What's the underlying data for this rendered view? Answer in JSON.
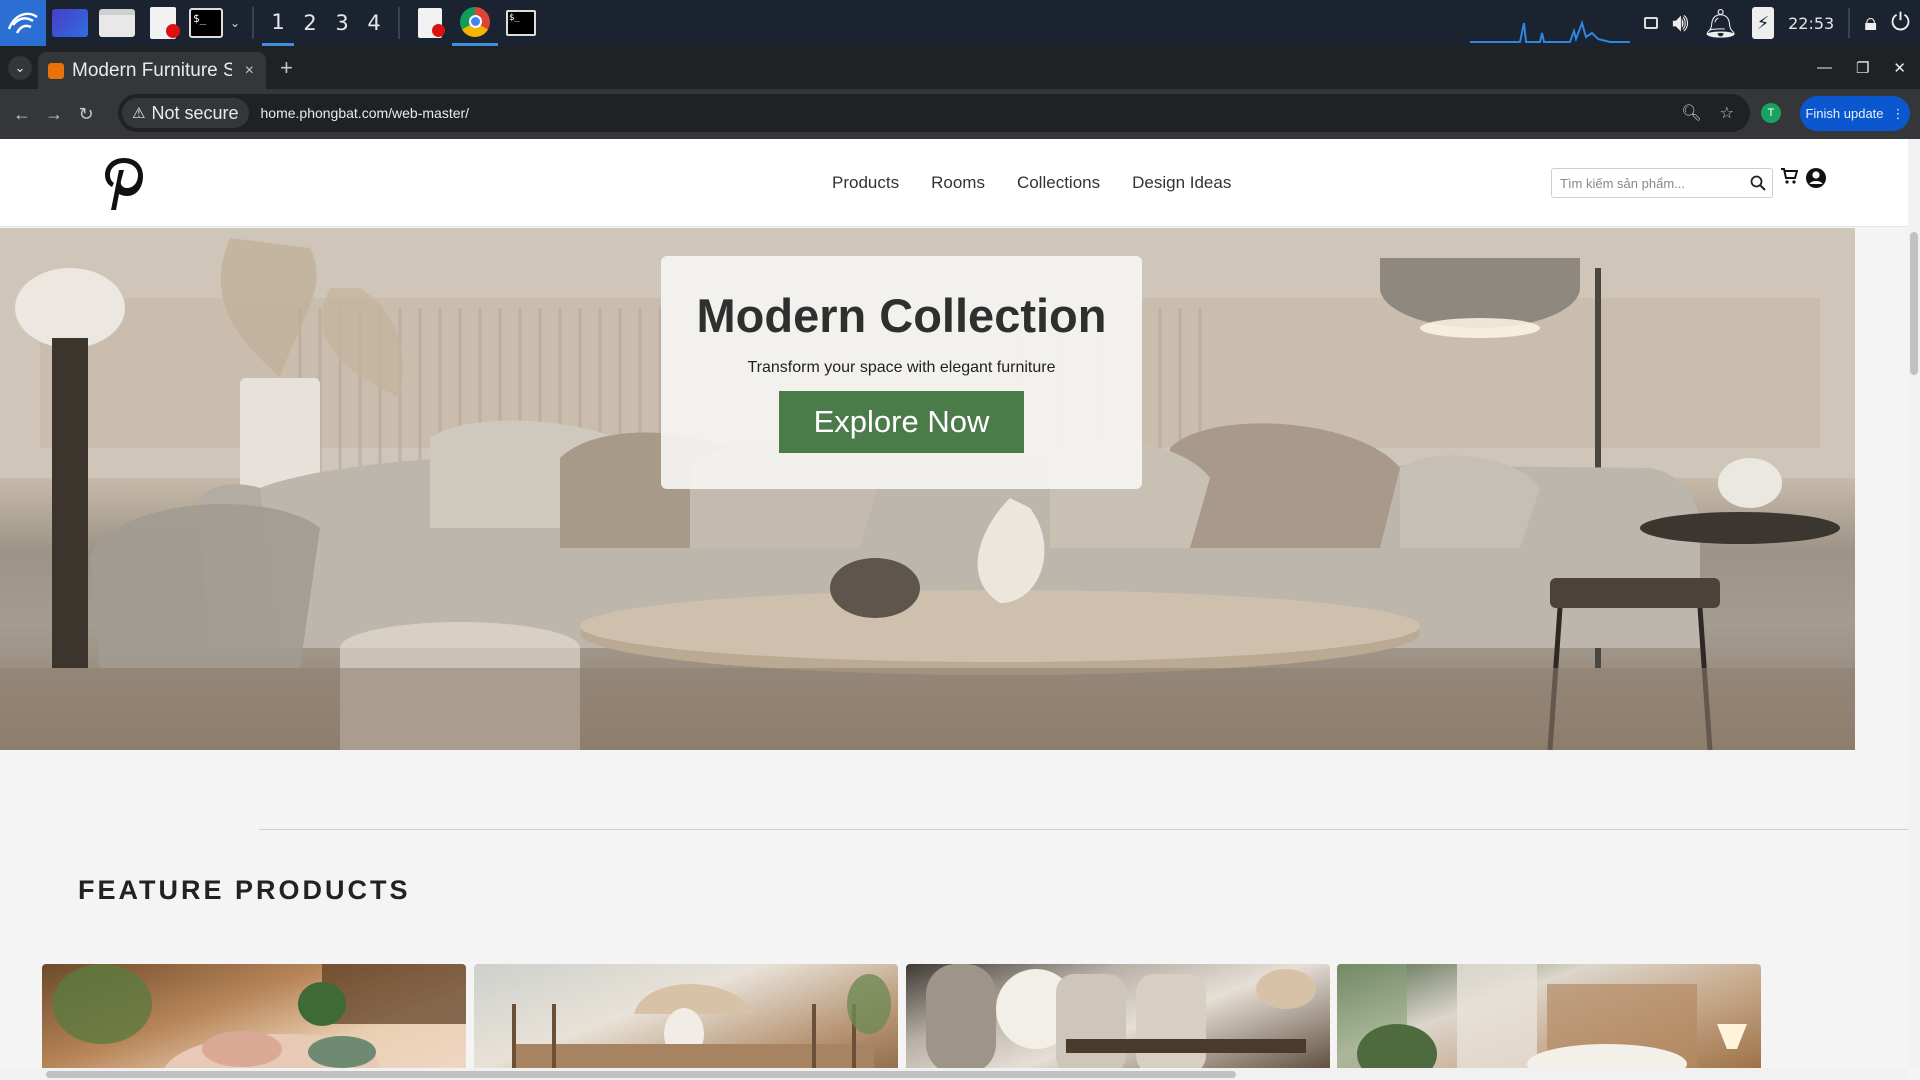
{
  "taskbar": {
    "workspaces": [
      "1",
      "2",
      "3",
      "4"
    ],
    "active_workspace": "1",
    "clock": "22:53",
    "icons": [
      "kali-menu-icon",
      "desktop-icon",
      "file-manager-icon",
      "text-editor-icon",
      "terminal-icon",
      "text-editor-icon",
      "chrome-icon",
      "terminal-icon"
    ],
    "tray_icons": [
      "display-icon",
      "volume-icon",
      "notification-bell-icon",
      "battery-charging-icon",
      "lock-icon",
      "logout-icon"
    ]
  },
  "browser": {
    "tab_title": "Modern Furniture S",
    "new_tab": "+",
    "close_tab": "×",
    "security_label": "Not secure",
    "url": "home.phongbat.com/web-master/",
    "profile_initial": "T",
    "update_button": "Finish update"
  },
  "site": {
    "logo": "pinterest-logo",
    "nav": [
      "Products",
      "Rooms",
      "Collections",
      "Design Ideas"
    ],
    "search_placeholder": "Tìm kiếm sản phẩm..."
  },
  "hero": {
    "title": "Modern Collection",
    "subtitle": "Transform your space with elegant furniture",
    "cta": "Explore Now",
    "accent": "#4b7b48"
  },
  "features": {
    "title": "FEATURE PRODUCTS"
  }
}
